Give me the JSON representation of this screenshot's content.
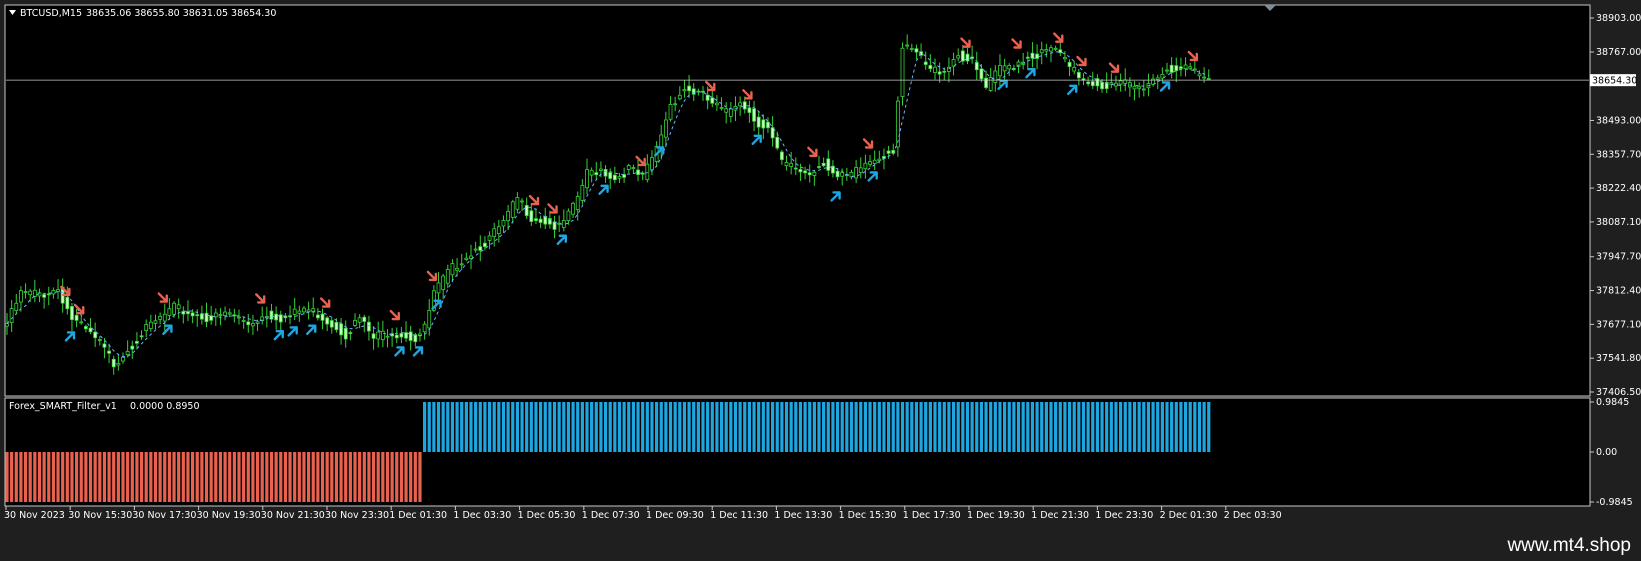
{
  "chart_data": {
    "type": "candlestick",
    "symbol_label": "BTCUSD,M15",
    "ohlc_header": "38635.06 38655.80 38631.05 38654.30",
    "price_axis_labels": [
      "38903.00",
      "38767.00",
      "38654.30",
      "38493.00",
      "38357.70",
      "38222.40",
      "38087.10",
      "37947.70",
      "37812.40",
      "37677.10",
      "37541.80",
      "37406.50"
    ],
    "price_ticks": [
      38903.0,
      38767.0,
      38493.0,
      38357.7,
      38222.4,
      38087.1,
      37947.7,
      37812.4,
      37677.1,
      37541.8,
      37406.5
    ],
    "ylim": [
      37406.5,
      38970.0
    ],
    "current_price": 38654.3,
    "current_price_label": "38654.30",
    "time_axis_labels": [
      "30 Nov 2023",
      "30 Nov 15:30",
      "30 Nov 17:30",
      "30 Nov 19:30",
      "30 Nov 21:30",
      "30 Nov 23:30",
      "1 Dec 01:30",
      "1 Dec 03:30",
      "1 Dec 05:30",
      "1 Dec 07:30",
      "1 Dec 09:30",
      "1 Dec 11:30",
      "1 Dec 13:30",
      "1 Dec 15:30",
      "1 Dec 17:30",
      "1 Dec 19:30",
      "1 Dec 21:30",
      "1 Dec 23:30",
      "2 Dec 01:30",
      "2 Dec 03:30"
    ],
    "close_anchors": [
      [
        0,
        37680
      ],
      [
        3,
        37800
      ],
      [
        8,
        37800
      ],
      [
        11,
        37820
      ],
      [
        14,
        37700
      ],
      [
        17,
        37650
      ],
      [
        20,
        37600
      ],
      [
        23,
        37520
      ],
      [
        26,
        37580
      ],
      [
        29,
        37640
      ],
      [
        33,
        37700
      ],
      [
        36,
        37740
      ],
      [
        40,
        37720
      ],
      [
        44,
        37700
      ],
      [
        48,
        37720
      ],
      [
        52,
        37680
      ],
      [
        56,
        37720
      ],
      [
        60,
        37700
      ],
      [
        64,
        37740
      ],
      [
        67,
        37720
      ],
      [
        70,
        37680
      ],
      [
        73,
        37640
      ],
      [
        76,
        37700
      ],
      [
        79,
        37620
      ],
      [
        82,
        37650
      ],
      [
        85,
        37640
      ],
      [
        88,
        37620
      ],
      [
        90,
        37660
      ],
      [
        92,
        37800
      ],
      [
        95,
        37880
      ],
      [
        98,
        37940
      ],
      [
        101,
        37980
      ],
      [
        104,
        38020
      ],
      [
        107,
        38080
      ],
      [
        110,
        38180
      ],
      [
        113,
        38110
      ],
      [
        116,
        38090
      ],
      [
        119,
        38060
      ],
      [
        122,
        38140
      ],
      [
        125,
        38280
      ],
      [
        128,
        38300
      ],
      [
        131,
        38260
      ],
      [
        134,
        38300
      ],
      [
        137,
        38260
      ],
      [
        140,
        38380
      ],
      [
        143,
        38560
      ],
      [
        146,
        38620
      ],
      [
        149,
        38600
      ],
      [
        152,
        38560
      ],
      [
        155,
        38520
      ],
      [
        158,
        38580
      ],
      [
        161,
        38500
      ],
      [
        164,
        38460
      ],
      [
        167,
        38320
      ],
      [
        170,
        38300
      ],
      [
        173,
        38280
      ],
      [
        176,
        38330
      ],
      [
        179,
        38260
      ],
      [
        182,
        38270
      ],
      [
        185,
        38320
      ],
      [
        188,
        38350
      ],
      [
        191,
        38380
      ],
      [
        193,
        38780
      ],
      [
        196,
        38760
      ],
      [
        199,
        38690
      ],
      [
        202,
        38700
      ],
      [
        205,
        38760
      ],
      [
        208,
        38720
      ],
      [
        211,
        38620
      ],
      [
        214,
        38700
      ],
      [
        217,
        38720
      ],
      [
        220,
        38750
      ],
      [
        223,
        38760
      ],
      [
        226,
        38780
      ],
      [
        229,
        38700
      ],
      [
        232,
        38660
      ],
      [
        235,
        38640
      ],
      [
        238,
        38630
      ],
      [
        241,
        38640
      ],
      [
        244,
        38620
      ],
      [
        247,
        38660
      ],
      [
        250,
        38700
      ],
      [
        253,
        38700
      ],
      [
        256,
        38680
      ],
      [
        259,
        38654
      ]
    ],
    "indicator": {
      "name": "Forex_SMART_Filter_v1",
      "values_label": "0.0000 0.8950",
      "axis_labels": [
        "0.9845",
        "0.00",
        "-0.9845"
      ],
      "ylim": [
        -0.9845,
        0.9845
      ],
      "sell_value": -0.9845,
      "buy_value": 0.9845,
      "switch_index": 90,
      "bar_count": 260
    },
    "arrow_sell_indices": [
      13,
      16,
      34,
      55,
      69,
      84,
      92,
      114,
      118,
      137,
      152,
      160,
      174,
      186,
      207,
      218,
      227,
      232,
      239,
      256
    ],
    "arrow_buy_indices": [
      14,
      35,
      59,
      62,
      66,
      85,
      89,
      93,
      120,
      129,
      141,
      162,
      179,
      187,
      215,
      221,
      230,
      250
    ],
    "colors": {
      "background": "#000000",
      "frame": "#c8c8c8",
      "bull_candle": "#c8ffbe",
      "wick": "#36d436",
      "ma_line": "#69b4ff",
      "buy": "#1ea6e1",
      "sell": "#e9614f"
    }
  },
  "watermark": "www.mt4.shop"
}
